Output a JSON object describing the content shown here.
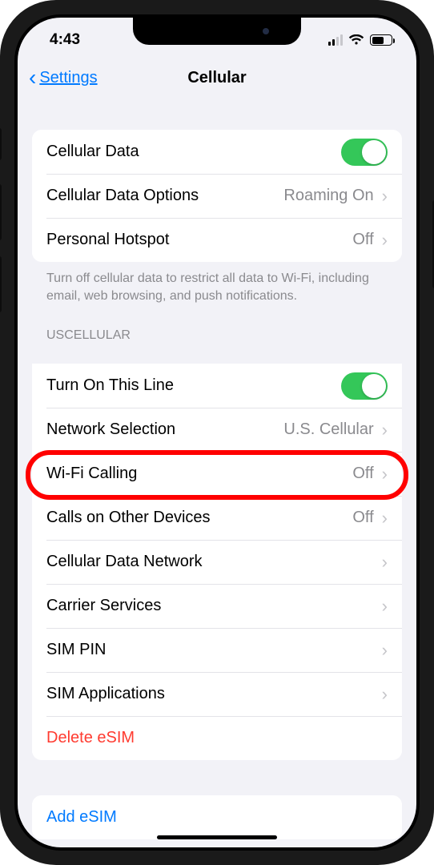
{
  "status": {
    "time": "4:43"
  },
  "nav": {
    "back": "Settings",
    "title": "Cellular"
  },
  "group1": {
    "cellular_data": {
      "label": "Cellular Data",
      "on": true
    },
    "options": {
      "label": "Cellular Data Options",
      "value": "Roaming On"
    },
    "hotspot": {
      "label": "Personal Hotspot",
      "value": "Off"
    },
    "footer": "Turn off cellular data to restrict all data to Wi-Fi, including email, web browsing, and push notifications."
  },
  "carrier_header": "USCELLULAR",
  "group2": {
    "line_on": {
      "label": "Turn On This Line",
      "on": true
    },
    "network": {
      "label": "Network Selection",
      "value": "U.S. Cellular"
    },
    "wifi_calling": {
      "label": "Wi-Fi Calling",
      "value": "Off"
    },
    "other_devices": {
      "label": "Calls on Other Devices",
      "value": "Off"
    },
    "data_network": {
      "label": "Cellular Data Network"
    },
    "carrier_services": {
      "label": "Carrier Services"
    },
    "sim_pin": {
      "label": "SIM PIN"
    },
    "sim_apps": {
      "label": "SIM Applications"
    },
    "delete_esim": {
      "label": "Delete eSIM"
    }
  },
  "group3": {
    "add_esim": {
      "label": "Add eSIM"
    }
  }
}
